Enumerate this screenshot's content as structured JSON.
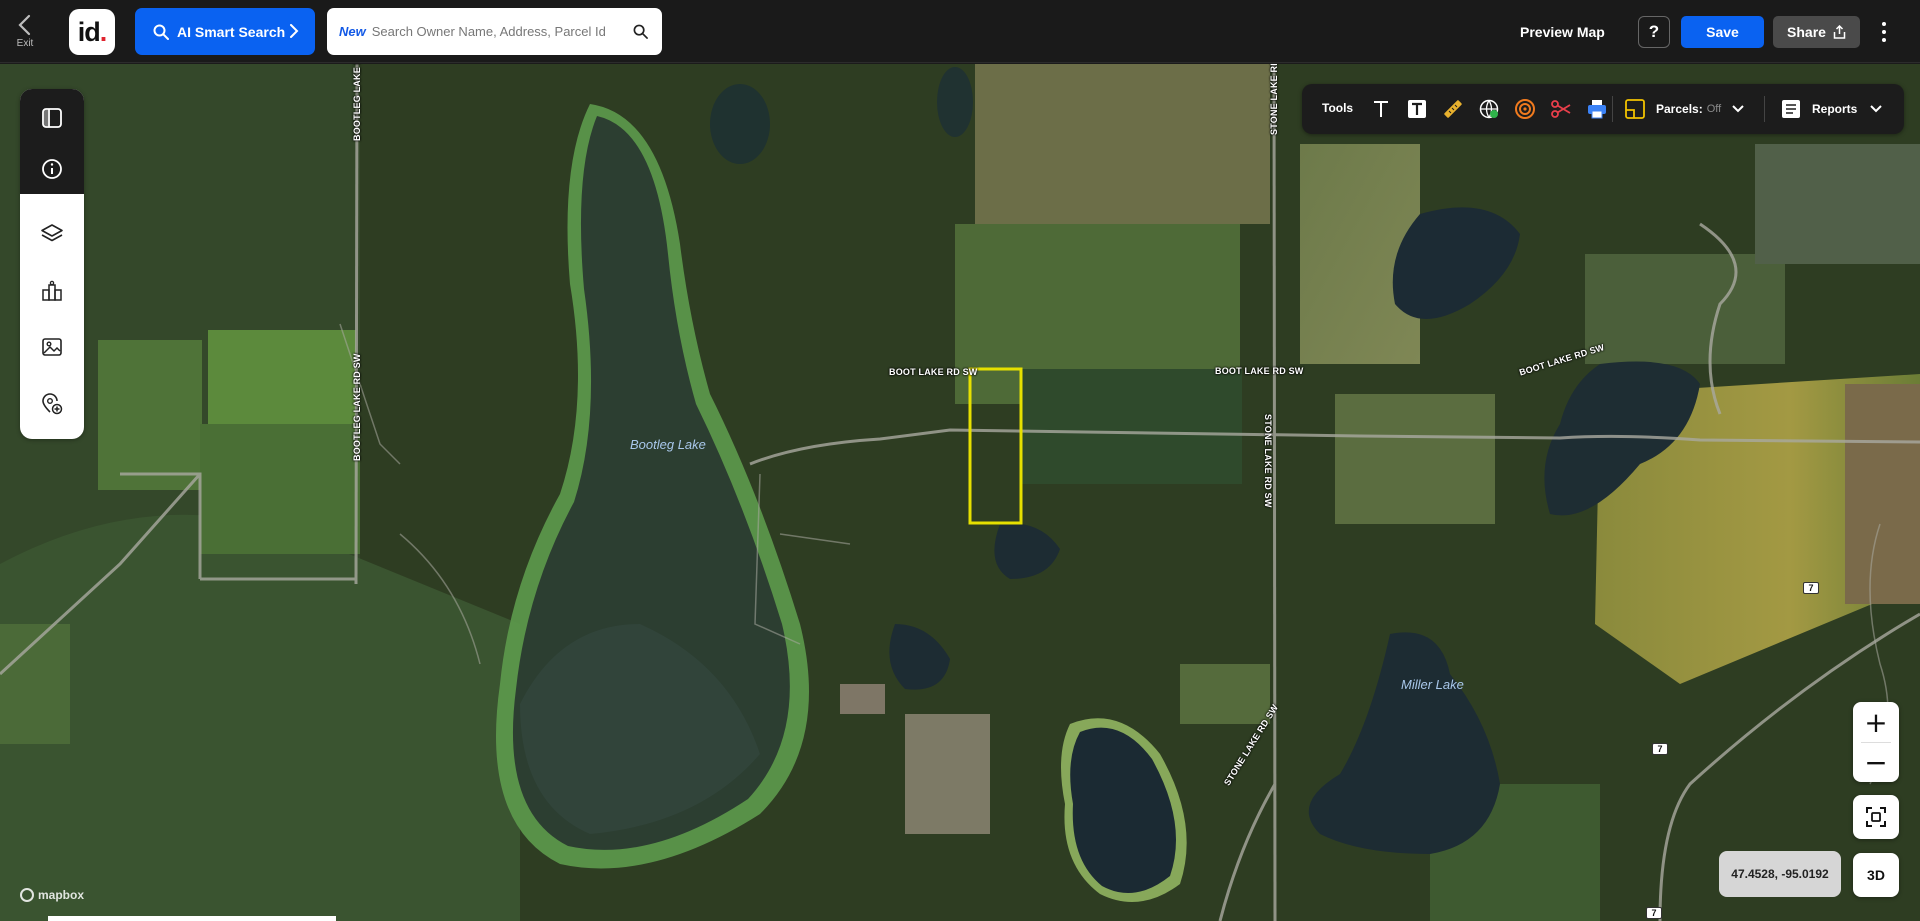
{
  "topbar": {
    "exit_label": "Exit",
    "logo_text": "id",
    "logo_dot": ".",
    "ai_search_label": "AI Smart Search",
    "search_new_badge": "New",
    "search_placeholder": "Search Owner Name, Address, Parcel Id",
    "search_value": "",
    "preview_map_label": "Preview Map",
    "help_label": "?",
    "save_label": "Save",
    "share_label": "Share"
  },
  "leftbar": {
    "items": [
      {
        "icon": "panel-toggle-icon"
      },
      {
        "icon": "info-icon"
      },
      {
        "icon": "layers-icon"
      },
      {
        "icon": "buildings-icon"
      },
      {
        "icon": "image-icon"
      },
      {
        "icon": "add-location-icon"
      }
    ]
  },
  "tools": {
    "label": "Tools",
    "icons": [
      "text-icon",
      "text-box-icon",
      "ruler-icon",
      "globe-icon",
      "target-icon",
      "scissors-icon",
      "print-icon"
    ],
    "parcels_label": "Parcels:",
    "parcels_state": "Off",
    "reports_label": "Reports"
  },
  "map_labels": {
    "roads": {
      "bootleg_north": "BOOTLEG LAKE RD SW",
      "bootleg_south": "BOOTLEG LAKE RD SW",
      "stone_north": "STONE LAKE RD",
      "stone_mid": "STONE LAKE RD SW",
      "stone_south": "STONE LAKE RD SW",
      "boot_west": "BOOT LAKE RD SW",
      "boot_mid": "BOOT LAKE RD SW",
      "boot_east": "BOOT LAKE RD SW"
    },
    "water": {
      "bootleg_lake": "Bootleg Lake",
      "miller_lake": "Miller Lake"
    },
    "routes": [
      "7",
      "7",
      "7"
    ]
  },
  "controls": {
    "zoom_in": "+",
    "zoom_out": "−",
    "coordinates": "47.4528, -95.0192",
    "three_d_label": "3D"
  },
  "attribution": "mapbox",
  "colors": {
    "accent_blue": "#0a62f1",
    "selection_yellow": "#e6e000",
    "topbar_bg": "#1a1a1a"
  }
}
